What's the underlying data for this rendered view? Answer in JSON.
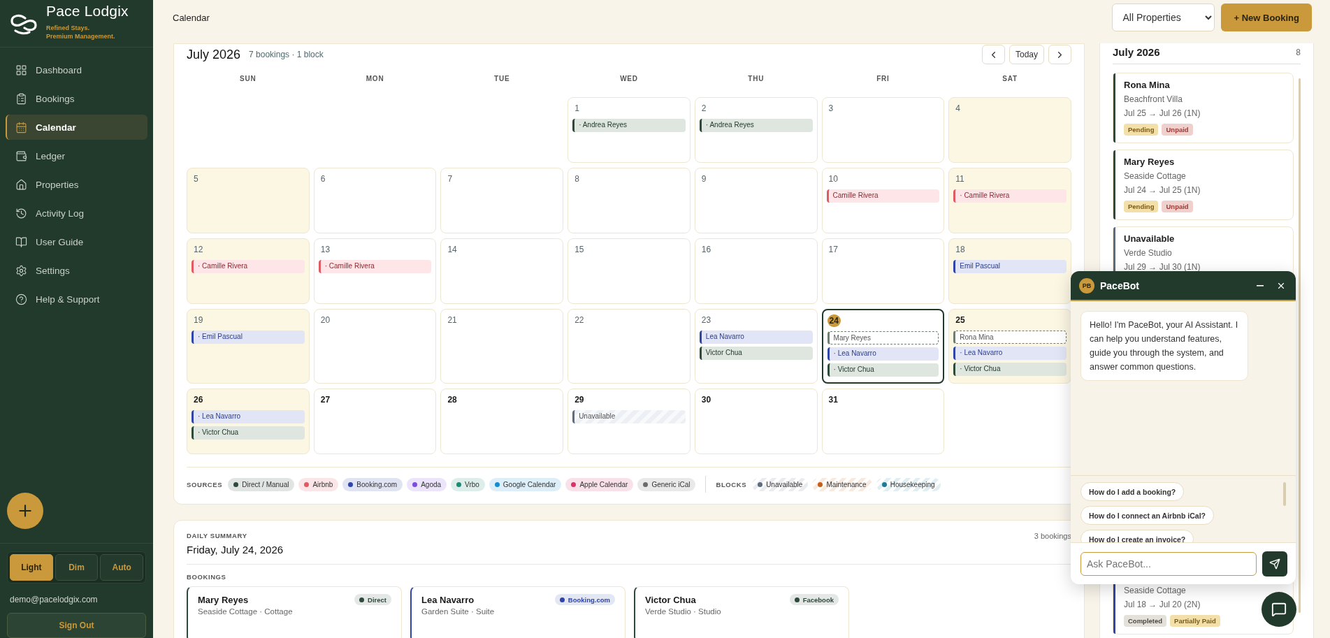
{
  "brand": {
    "name": "Pace Lodgix",
    "tagline_1": "Refined Stays.",
    "tagline_2": "Premium Management."
  },
  "nav": [
    {
      "label": "Dashboard",
      "selected": false
    },
    {
      "label": "Bookings",
      "selected": false
    },
    {
      "label": "Calendar",
      "selected": true
    },
    {
      "label": "Ledger",
      "selected": false
    },
    {
      "label": "Properties",
      "selected": false
    },
    {
      "label": "Activity Log",
      "selected": false
    },
    {
      "label": "User Guide",
      "selected": false
    },
    {
      "label": "Settings",
      "selected": false
    },
    {
      "label": "Help & Support",
      "selected": false
    }
  ],
  "theme_options": [
    {
      "label": "Light",
      "selected": true
    },
    {
      "label": "Dim",
      "selected": false
    },
    {
      "label": "Auto",
      "selected": false
    }
  ],
  "user_email": "demo@pacelodgix.com",
  "sign_out": "Sign Out",
  "header": {
    "title": "Calendar",
    "property_filter": "All Properties",
    "new_booking": "+ New Booking"
  },
  "calendar": {
    "title": "July 2026",
    "summary": "7 bookings · 1 block",
    "today_button": "Today",
    "weekdays": [
      "SUN",
      "MON",
      "TUE",
      "WED",
      "THU",
      "FRI",
      "SAT"
    ],
    "cells": [
      {
        "kind": "blank"
      },
      {
        "kind": "blank"
      },
      {
        "kind": "blank"
      },
      {
        "kind": "day",
        "date": "1",
        "weekend": false,
        "past": true,
        "today": false,
        "events": [
          {
            "label": "· Andrea Reyes",
            "kind": "direct"
          }
        ]
      },
      {
        "kind": "day",
        "date": "2",
        "weekend": false,
        "past": true,
        "today": false,
        "events": [
          {
            "label": "· Andrea Reyes",
            "kind": "direct"
          }
        ]
      },
      {
        "kind": "day",
        "date": "3",
        "weekend": false,
        "past": true,
        "today": false
      },
      {
        "kind": "day",
        "date": "4",
        "weekend": true,
        "past": true,
        "today": false
      },
      {
        "kind": "day",
        "date": "5",
        "weekend": true,
        "past": true,
        "today": false
      },
      {
        "kind": "day",
        "date": "6",
        "weekend": false,
        "past": true,
        "today": false
      },
      {
        "kind": "day",
        "date": "7",
        "weekend": false,
        "past": true,
        "today": false
      },
      {
        "kind": "day",
        "date": "8",
        "weekend": false,
        "past": true,
        "today": false
      },
      {
        "kind": "day",
        "date": "9",
        "weekend": false,
        "past": true,
        "today": false
      },
      {
        "kind": "day",
        "date": "10",
        "weekend": false,
        "past": true,
        "today": false,
        "events": [
          {
            "label": "Camille Rivera",
            "kind": "airbnb"
          }
        ]
      },
      {
        "kind": "day",
        "date": "11",
        "weekend": true,
        "past": true,
        "today": false,
        "events": [
          {
            "label": "· Camille Rivera",
            "kind": "airbnb"
          }
        ]
      },
      {
        "kind": "day",
        "date": "12",
        "weekend": true,
        "past": true,
        "today": false,
        "events": [
          {
            "label": "· Camille Rivera",
            "kind": "airbnb"
          }
        ]
      },
      {
        "kind": "day",
        "date": "13",
        "weekend": false,
        "past": true,
        "today": false,
        "events": [
          {
            "label": "· Camille Rivera",
            "kind": "airbnb"
          }
        ]
      },
      {
        "kind": "day",
        "date": "14",
        "weekend": false,
        "past": true,
        "today": false
      },
      {
        "kind": "day",
        "date": "15",
        "weekend": false,
        "past": true,
        "today": false
      },
      {
        "kind": "day",
        "date": "16",
        "weekend": false,
        "past": true,
        "today": false
      },
      {
        "kind": "day",
        "date": "17",
        "weekend": false,
        "past": true,
        "today": false
      },
      {
        "kind": "day",
        "date": "18",
        "weekend": true,
        "past": true,
        "today": false,
        "events": [
          {
            "label": "Emil Pascual",
            "kind": "booking"
          }
        ]
      },
      {
        "kind": "day",
        "date": "19",
        "weekend": true,
        "past": true,
        "today": false,
        "events": [
          {
            "label": "· Emil Pascual",
            "kind": "booking"
          }
        ]
      },
      {
        "kind": "day",
        "date": "20",
        "weekend": false,
        "past": true,
        "today": false
      },
      {
        "kind": "day",
        "date": "21",
        "weekend": false,
        "past": true,
        "today": false
      },
      {
        "kind": "day",
        "date": "22",
        "weekend": false,
        "past": true,
        "today": false
      },
      {
        "kind": "day",
        "date": "23",
        "weekend": false,
        "past": true,
        "today": false,
        "events": [
          {
            "label": "Lea Navarro",
            "kind": "booking"
          },
          {
            "label": "Victor Chua",
            "kind": "direct"
          }
        ]
      },
      {
        "kind": "day",
        "date": "24",
        "weekend": false,
        "past": false,
        "today": true,
        "events": [
          {
            "label": "Mary Reyes",
            "kind": "pending"
          },
          {
            "label": "· Lea Navarro",
            "kind": "booking"
          },
          {
            "label": "· Victor Chua",
            "kind": "direct"
          }
        ]
      },
      {
        "kind": "day",
        "date": "25",
        "weekend": true,
        "past": false,
        "today": false,
        "events": [
          {
            "label": "Rona Mina",
            "kind": "pending"
          },
          {
            "label": "· Lea Navarro",
            "kind": "booking"
          },
          {
            "label": "· Victor Chua",
            "kind": "direct"
          }
        ]
      },
      {
        "kind": "day",
        "date": "26",
        "weekend": true,
        "past": false,
        "today": false,
        "events": [
          {
            "label": "· Lea Navarro",
            "kind": "booking"
          },
          {
            "label": "· Victor Chua",
            "kind": "direct"
          }
        ]
      },
      {
        "kind": "day",
        "date": "27",
        "weekend": false,
        "past": false,
        "today": false
      },
      {
        "kind": "day",
        "date": "28",
        "weekend": false,
        "past": false,
        "today": false
      },
      {
        "kind": "day",
        "date": "29",
        "weekend": false,
        "past": false,
        "today": false,
        "events": [
          {
            "label": "Unavailable",
            "kind": "block"
          }
        ]
      },
      {
        "kind": "day",
        "date": "30",
        "weekend": false,
        "past": false,
        "today": false
      },
      {
        "kind": "day",
        "date": "31",
        "weekend": false,
        "past": false,
        "today": false
      }
    ],
    "sources_label": "SOURCES",
    "sources": [
      {
        "label": "Direct / Manual",
        "color": "#2d4a3a"
      },
      {
        "label": "Airbnb",
        "color": "#e05a63"
      },
      {
        "label": "Booking.com",
        "color": "#2f45a8"
      },
      {
        "label": "Agoda",
        "color": "#7c4ddb"
      },
      {
        "label": "Vrbo",
        "color": "#1e8a74"
      },
      {
        "label": "Google Calendar",
        "color": "#1a8ad0"
      },
      {
        "label": "Apple Calendar",
        "color": "#d6336c"
      },
      {
        "label": "Generic iCal",
        "color": "#6b6b6b"
      }
    ],
    "blocks_label": "BLOCKS",
    "blocks": [
      {
        "label": "Unavailable",
        "color": "#5e6b80"
      },
      {
        "label": "Maintenance",
        "color": "#c0601a"
      },
      {
        "label": "Housekeeping",
        "color": "#1d7a99"
      }
    ]
  },
  "daily_summary": {
    "heading": "DAILY SUMMARY",
    "date": "Friday, July 24, 2026",
    "count": "3 bookings",
    "bookings_heading": "BOOKINGS",
    "bookings": [
      {
        "guest": "Mary Reyes",
        "property": "Seaside Cottage · Cottage",
        "source": "Direct",
        "color": "#2d4a3a"
      },
      {
        "guest": "Lea Navarro",
        "property": "Garden Suite · Suite",
        "source": "Booking.com",
        "color": "#2f45a8"
      },
      {
        "guest": "Victor Chua",
        "property": "Verde Studio · Studio",
        "source": "Facebook",
        "color": "#2d4a3a"
      }
    ]
  },
  "month_list": {
    "title": "July 2026",
    "count": "8",
    "items": [
      {
        "guest": "Rona Mina",
        "property": "Beachfront Villa",
        "dates": "Jul 25 → Jul 26 (1N)",
        "color": "#2d4a3a",
        "badges": [
          {
            "label": "Pending",
            "kind": "pending"
          },
          {
            "label": "Unpaid",
            "kind": "unpaid"
          }
        ]
      },
      {
        "guest": "Mary Reyes",
        "property": "Seaside Cottage",
        "dates": "Jul 24 → Jul 25 (1N)",
        "color": "#2d4a3a",
        "badges": [
          {
            "label": "Pending",
            "kind": "pending"
          },
          {
            "label": "Unpaid",
            "kind": "unpaid"
          }
        ]
      },
      {
        "guest": "Unavailable",
        "property": "Verde Studio",
        "dates": "Jul 29 → Jul 30 (1N)",
        "color": "#5e6b80"
      },
      {
        "property": "Seaside Cottage",
        "dates": "Jul 18 → Jul 20 (2N)",
        "color": "#2f45a8",
        "badges": [
          {
            "label": "Completed",
            "kind": "completed"
          },
          {
            "label": "Partially Paid",
            "kind": "partial"
          }
        ]
      }
    ]
  },
  "chat": {
    "avatar": "PB",
    "title": "PaceBot",
    "message": "Hello! I'm PaceBot, your AI Assistant. I can help you understand features, guide you through the system, and answer common questions.",
    "suggestions": [
      "How do I add a booking?",
      "How do I connect an Airbnb iCal?",
      "How do I create an invoice?"
    ],
    "placeholder": "Ask PaceBot..."
  }
}
